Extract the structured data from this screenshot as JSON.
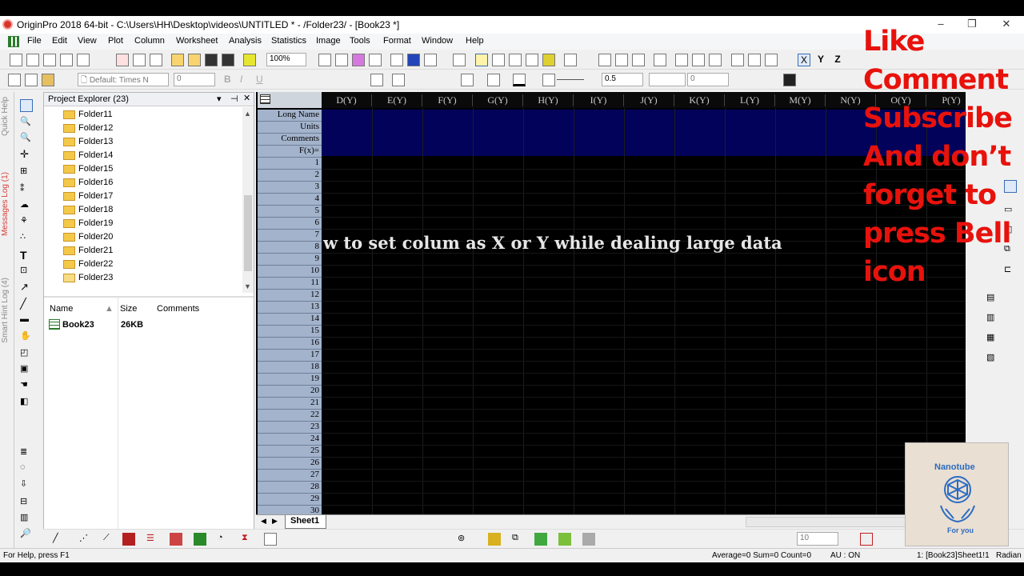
{
  "window": {
    "title": "OriginPro 2018 64-bit - C:\\Users\\HH\\Desktop\\videos\\UNTITLED * - /Folder23/ - [Book23 *]"
  },
  "menu": [
    "File",
    "Edit",
    "View",
    "Plot",
    "Column",
    "Worksheet",
    "Analysis",
    "Statistics",
    "Image",
    "Tools",
    "Format",
    "Window",
    "Help"
  ],
  "toolbar": {
    "zoom": "100%",
    "font": "Default: Times N",
    "font_size": "0",
    "line_width": "0.5",
    "value_zero": "0",
    "xyz": [
      "X",
      "Y",
      "Z"
    ]
  },
  "sidebar_tabs": [
    "Quick Help",
    "Messages Log (1)",
    "Smart Hint Log (4)"
  ],
  "explorer": {
    "title": "Project Explorer (23)",
    "folders": [
      "Folder11",
      "Folder12",
      "Folder13",
      "Folder14",
      "Folder15",
      "Folder16",
      "Folder17",
      "Folder18",
      "Folder19",
      "Folder20",
      "Folder21",
      "Folder22",
      "Folder23"
    ],
    "columns": [
      "Name",
      "Size",
      "Comments"
    ],
    "files": [
      {
        "name": "Book23",
        "size": "26KB",
        "comments": ""
      }
    ]
  },
  "worksheet": {
    "columns": [
      "D(Y)",
      "E(Y)",
      "F(Y)",
      "G(Y)",
      "H(Y)",
      "I(Y)",
      "J(Y)",
      "K(Y)",
      "L(Y)",
      "M(Y)",
      "N(Y)",
      "O(Y)",
      "P(Y)"
    ],
    "header_rows": [
      "Long Name",
      "Units",
      "Comments",
      "F(x)="
    ],
    "rows": [
      "1",
      "2",
      "3",
      "4",
      "5",
      "6",
      "7",
      "8",
      "9",
      "10",
      "11",
      "12",
      "13",
      "14",
      "15",
      "16",
      "17",
      "18",
      "19",
      "20",
      "21",
      "22",
      "23",
      "24",
      "25",
      "26",
      "27",
      "28",
      "29",
      "30"
    ],
    "overlay_text": "w to set colum as X or Y while dealing large data",
    "sheet_tab": "Sheet1"
  },
  "bottom_toolbar": {
    "size_value": "10"
  },
  "status": {
    "help": "For Help, press F1",
    "stats": "Average=0 Sum=0 Count=0",
    "au": "AU : ON",
    "location": "1: [Book23]Sheet1!1",
    "angle": "Radian"
  },
  "promo": {
    "lines": [
      "Like",
      "Comment",
      "Subscribe",
      "And don’t",
      "forget to",
      "press Bell",
      "icon"
    ],
    "color": "#e8120c"
  },
  "logo": {
    "top_text": "Nanotube",
    "bottom_text": "For you"
  }
}
